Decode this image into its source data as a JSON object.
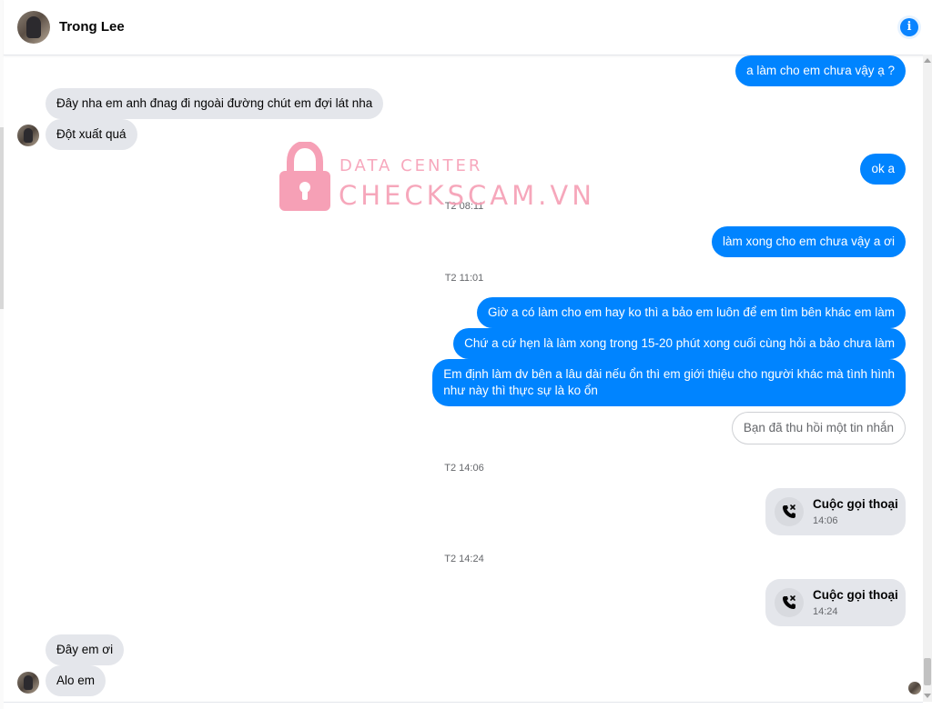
{
  "header": {
    "contact_name": "Trong Lee",
    "info_icon": "info-icon"
  },
  "messages": {
    "m1": "a làm cho em chưa vậy ạ ?",
    "m2": "Đây nha em anh đnag đi ngoài đường chút em đợi lát nha",
    "m3": "Đột xuất quá",
    "m4": "ok a",
    "m5": "làm xong cho em chưa vậy a ơi",
    "m6": "Giờ a có làm cho em hay ko thì a bảo em luôn để em tìm bên khác em làm",
    "m7": "Chứ a cứ hẹn là làm xong trong 15-20 phút xong cuối cùng hỏi a bảo chưa làm",
    "m8_line1": "Em định làm dv bên a lâu dài nếu ổn thì em giới thiệu cho người khác mà tình hình",
    "m8_line2": "như này thì thực sự là ko ổn",
    "recalled": "Bạn đã thu hồi một tin nhắn",
    "m9": "Đây em ơi",
    "m10": "Alo em"
  },
  "timestamps": {
    "t1": "T2 08:11",
    "t2": "T2 11:01",
    "t3": "T2 14:06",
    "t4": "T2 14:24"
  },
  "calls": [
    {
      "title": "Cuộc gọi thoại",
      "time": "14:06",
      "icon": "missed-call-icon"
    },
    {
      "title": "Cuộc gọi thoại",
      "time": "14:24",
      "icon": "missed-call-icon"
    }
  ],
  "watermark": {
    "line1": "DATA CENTER",
    "line2": "CHECKSCAM.VN"
  },
  "colors": {
    "outgoing": "#0084ff",
    "incoming": "#e4e6eb",
    "watermark": "#f6a0b6"
  }
}
